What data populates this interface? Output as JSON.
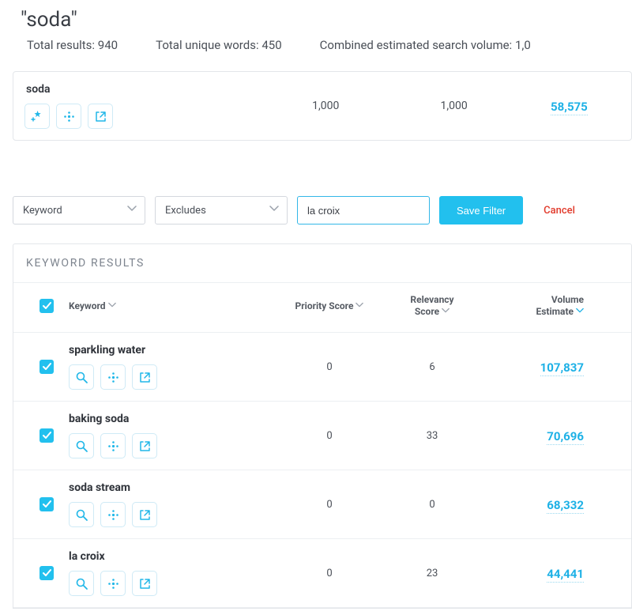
{
  "title": "\"soda\"",
  "summary": {
    "total_results_label": "Total results:",
    "total_results": "940",
    "total_unique_label": "Total unique words:",
    "total_unique": "450",
    "combined_volume_label": "Combined estimated search volume:",
    "combined_volume": "1,0"
  },
  "seed_card": {
    "keyword": "soda",
    "col1": "1,000",
    "col2": "1,000",
    "volume": "58,575"
  },
  "filter": {
    "field": "Keyword",
    "operator": "Excludes",
    "value": "la croix",
    "save_label": "Save Filter",
    "cancel_label": "Cancel"
  },
  "results": {
    "section_title": "KEYWORD RESULTS",
    "headers": {
      "keyword": "Keyword",
      "priority": "Priority Score",
      "relevancy_l1": "Relevancy",
      "relevancy_l2": "Score",
      "volume_l1": "Volume",
      "volume_l2": "Estimate"
    },
    "rows": [
      {
        "keyword": "sparkling water",
        "priority": "0",
        "relevancy": "6",
        "volume": "107,837"
      },
      {
        "keyword": "baking soda",
        "priority": "0",
        "relevancy": "33",
        "volume": "70,696"
      },
      {
        "keyword": "soda stream",
        "priority": "0",
        "relevancy": "0",
        "volume": "68,332"
      },
      {
        "keyword": "la croix",
        "priority": "0",
        "relevancy": "23",
        "volume": "44,441"
      }
    ]
  }
}
